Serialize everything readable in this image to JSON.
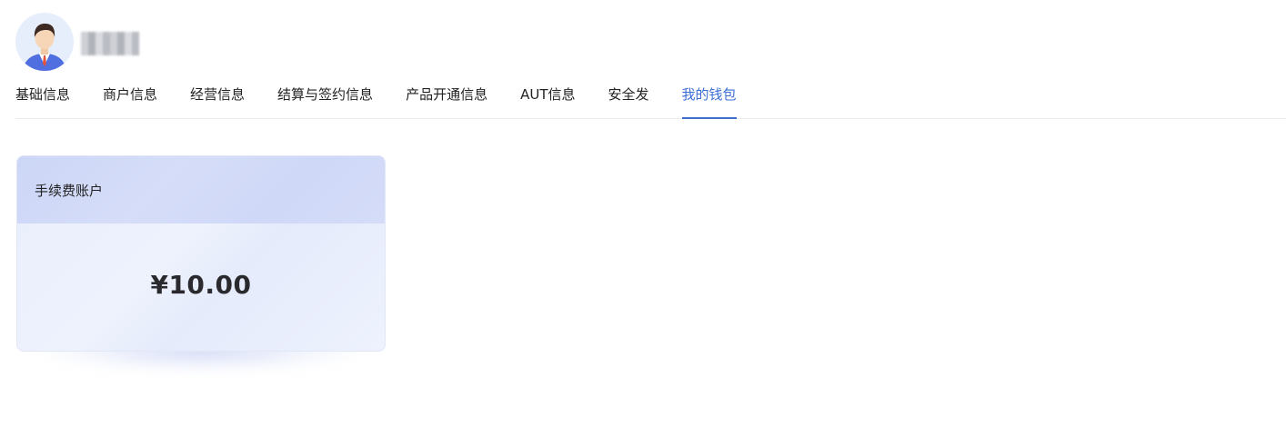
{
  "profile": {
    "name": "■■■■■"
  },
  "tabs": [
    {
      "label": "基础信息",
      "active": false
    },
    {
      "label": "商户信息",
      "active": false
    },
    {
      "label": "经营信息",
      "active": false
    },
    {
      "label": "结算与签约信息",
      "active": false
    },
    {
      "label": "产品开通信息",
      "active": false
    },
    {
      "label": "AUT信息",
      "active": false
    },
    {
      "label": "安全发",
      "active": false
    },
    {
      "label": "我的钱包",
      "active": true
    }
  ],
  "wallet": {
    "account_title": "手续费账户",
    "amount": "¥10.00"
  },
  "colors": {
    "accent": "#3b6fd6",
    "card_header": "#d2dbf7",
    "card_body": "#ecf0fd"
  }
}
